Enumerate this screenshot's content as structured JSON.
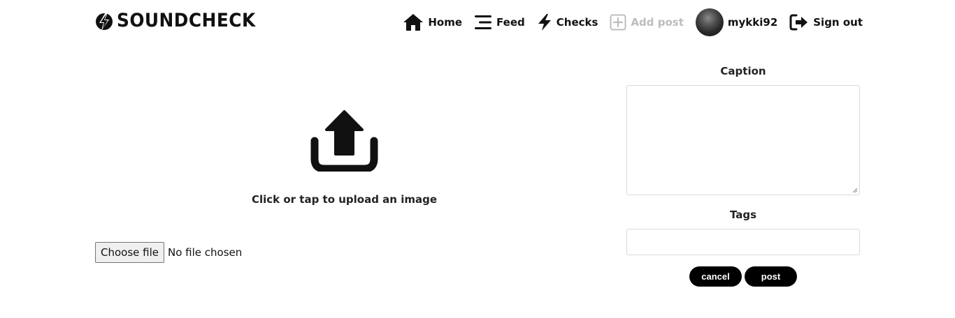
{
  "brand": {
    "name": "SOUNDCHECK"
  },
  "nav": {
    "home": "Home",
    "feed": "Feed",
    "checks": "Checks",
    "add_post": "Add post",
    "username": "mykki92",
    "sign_out": "Sign out"
  },
  "upload": {
    "prompt": "Click or tap to upload an image",
    "choose_file_label": "Choose file",
    "file_status": "No file chosen"
  },
  "form": {
    "caption_label": "Caption",
    "caption_value": "",
    "tags_label": "Tags",
    "tags_value": "",
    "cancel_label": "cancel",
    "post_label": "post"
  },
  "colors": {
    "text": "#111111",
    "disabled": "#bdbdbd",
    "button_bg": "#000000",
    "button_text": "#ffffff",
    "border": "#d9d9d9"
  }
}
